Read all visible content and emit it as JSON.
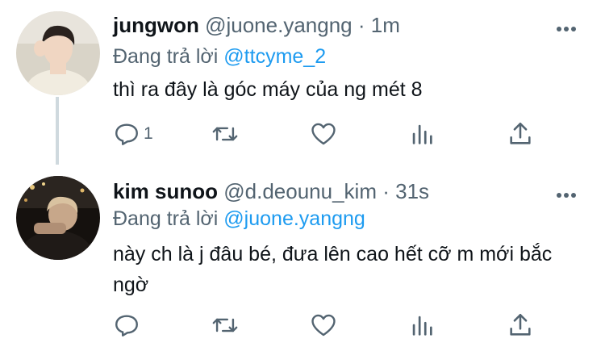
{
  "tweets": [
    {
      "name": "jungwon",
      "handle": "@juone.yangng",
      "dot": "·",
      "time": "1m",
      "reply_prefix": "Đang trả lời",
      "reply_to": "@ttcyme_2",
      "text": "thì ra đây là góc máy của ng mét 8",
      "reply_count": "1"
    },
    {
      "name": "kim sunoo",
      "handle": "@d.deounu_kim",
      "dot": "·",
      "time": "31s",
      "reply_prefix": "Đang trả lời",
      "reply_to": "@juone.yangng",
      "text": "này ch là j đâu bé, đưa lên cao hết cỡ m mới bắc ngờ",
      "reply_count": ""
    }
  ],
  "colors": {
    "accent": "#1d9bf0",
    "secondary_text": "#536471",
    "thread_line": "#cfd9de"
  },
  "icons": [
    "reply-icon",
    "retweet-icon",
    "like-icon",
    "analytics-icon",
    "share-icon",
    "more-icon"
  ]
}
